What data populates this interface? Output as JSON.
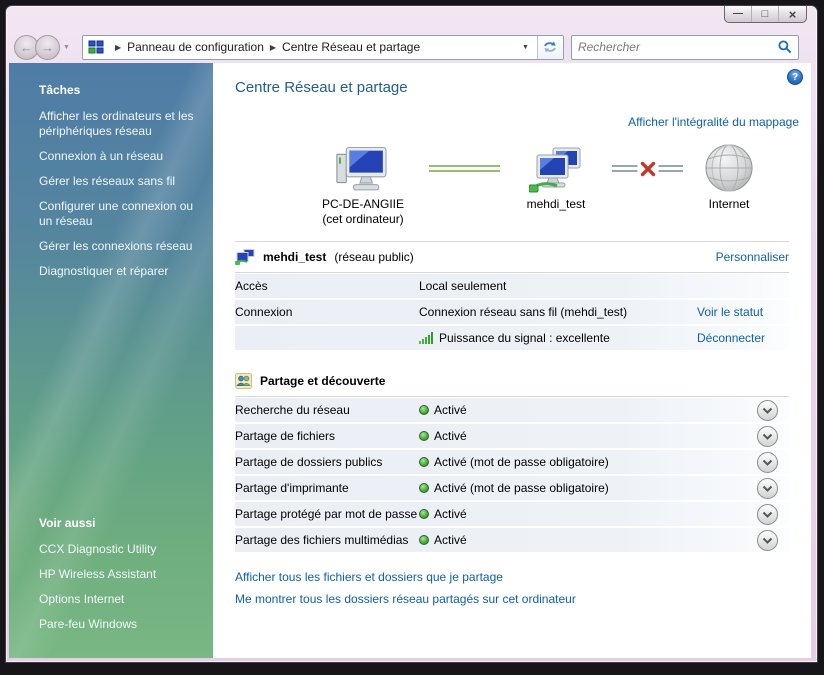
{
  "icons": {
    "minimize": "—",
    "maximize": "□",
    "close": "×",
    "back": "←",
    "forward": "→",
    "dropdown": "▼",
    "crumb_sep": "▶",
    "help": "?"
  },
  "toolbar": {
    "crumbs": [
      "Panneau de configuration",
      "Centre Réseau et partage"
    ],
    "search_placeholder": "Rechercher"
  },
  "sidebar": {
    "tasks_header": "Tâches",
    "tasks": [
      "Afficher les ordinateurs et les périphériques réseau",
      "Connexion à un réseau",
      "Gérer les réseaux sans fil",
      "Configurer une connexion ou un réseau",
      "Gérer les connexions réseau",
      "Diagnostiquer et réparer"
    ],
    "see_also_header": "Voir aussi",
    "see_also": [
      "CCX Diagnostic Utility",
      "HP Wireless Assistant",
      "Options Internet",
      "Pare-feu Windows"
    ]
  },
  "main": {
    "title": "Centre Réseau et partage",
    "map_link": "Afficher l'intégralité du mappage",
    "map": {
      "pc_label": "PC-DE-ANGIIE",
      "pc_sublabel": "(cet ordinateur)",
      "network_label": "mehdi_test",
      "internet_label": "Internet"
    },
    "network": {
      "name": "mehdi_test",
      "kind": "(réseau public)",
      "personalize": "Personnaliser",
      "rows": [
        {
          "label": "Accès",
          "value": "Local seulement",
          "link": ""
        },
        {
          "label": "Connexion",
          "value": "Connexion réseau sans fil (mehdi_test)",
          "link": "Voir le statut"
        },
        {
          "label": "",
          "value": "Puissance du signal : excellente",
          "link": "Déconnecter"
        }
      ]
    },
    "sharing": {
      "title": "Partage et découverte",
      "rows": [
        {
          "label": "Recherche du réseau",
          "status": "Activé"
        },
        {
          "label": "Partage de fichiers",
          "status": "Activé"
        },
        {
          "label": "Partage de dossiers publics",
          "status": "Activé (mot de passe obligatoire)"
        },
        {
          "label": "Partage d'imprimante",
          "status": "Activé (mot de passe obligatoire)"
        },
        {
          "label": "Partage protégé par mot de passe",
          "status": "Activé"
        },
        {
          "label": "Partage des fichiers multimédias",
          "status": "Activé"
        }
      ]
    },
    "footer_links": [
      "Afficher tous les fichiers et dossiers que je partage",
      "Me montrer tous les dossiers réseau partagés sur cet ordinateur"
    ]
  },
  "colors": {
    "link": "#0e5fad",
    "title": "#215e90",
    "status_green": "#3fae32",
    "error_red": "#c0392b",
    "sidebar_top": "#4f7ca6",
    "sidebar_bottom": "#79b884"
  }
}
